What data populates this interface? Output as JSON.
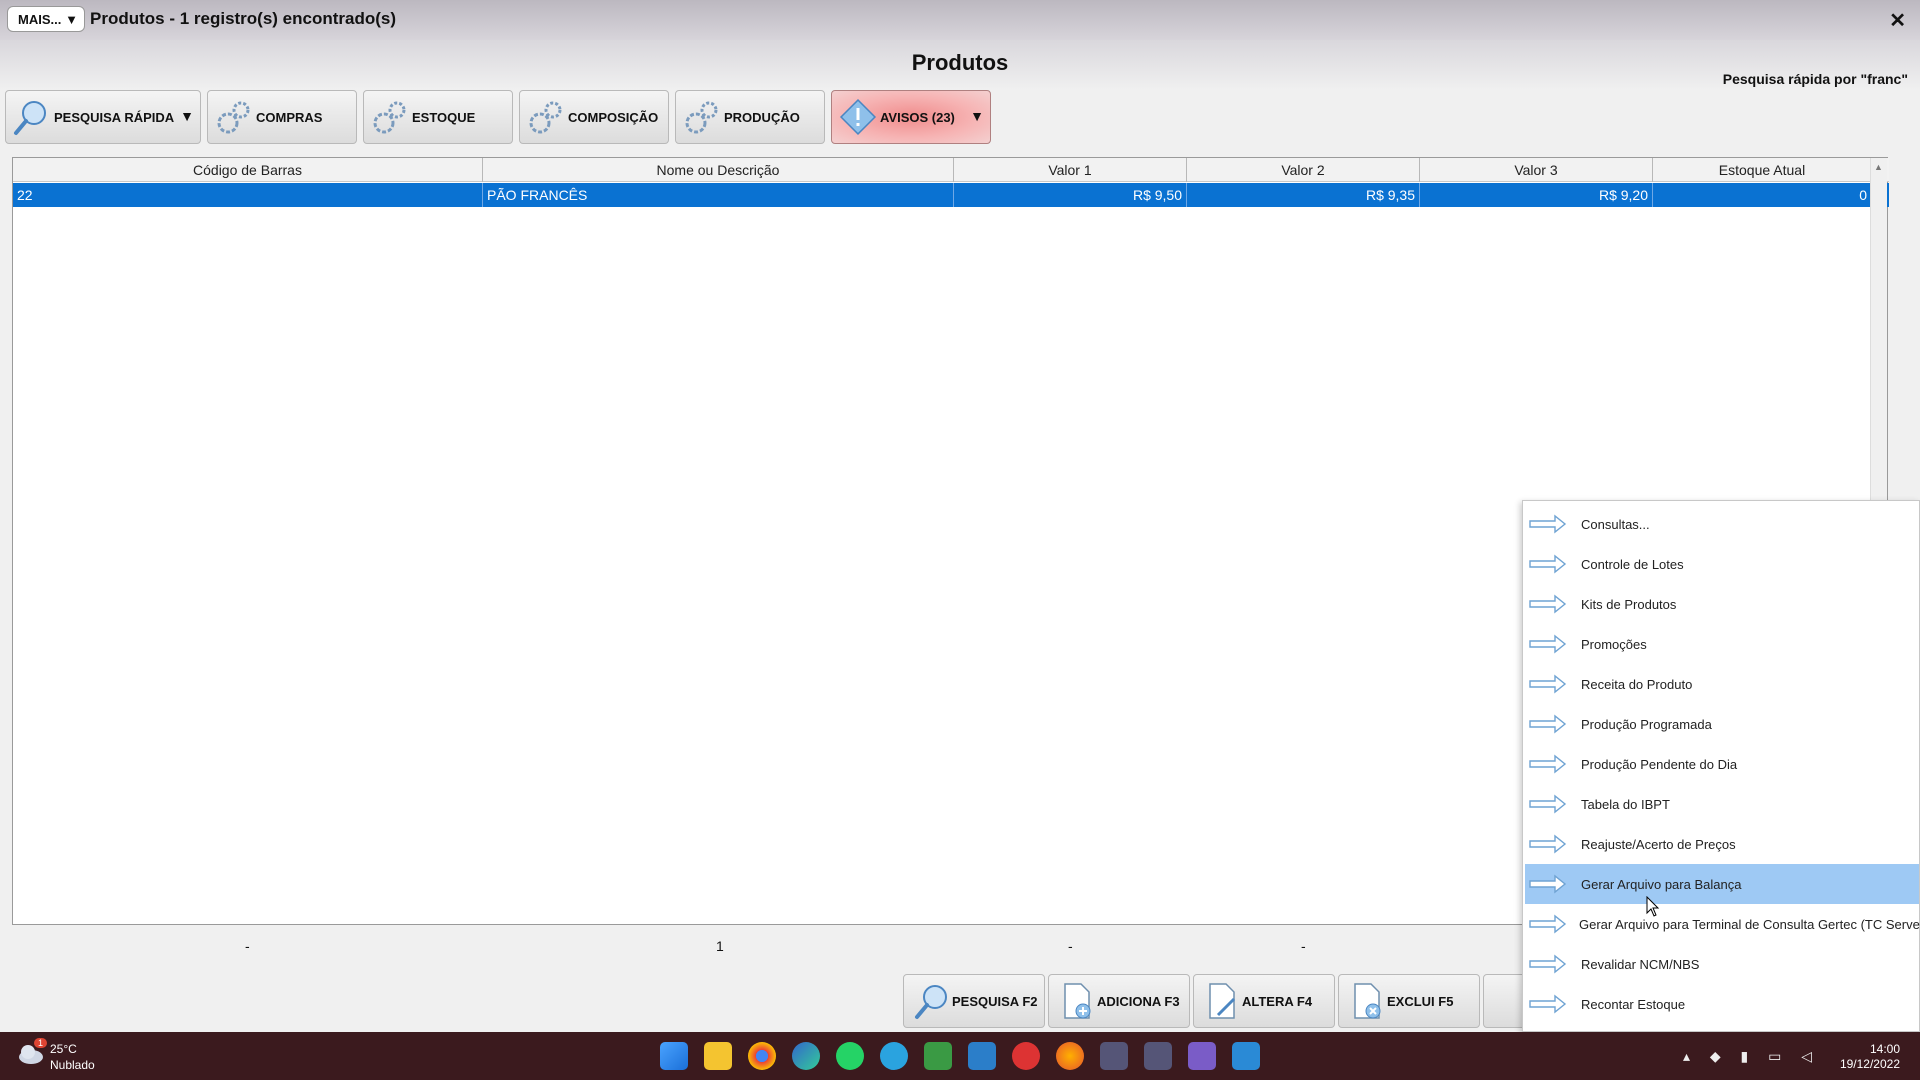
{
  "window": {
    "mais_label": "MAIS...",
    "title": "Produtos - 1 registro(s) encontrado(s)",
    "close": "✕"
  },
  "page_title": "Produtos",
  "quick_search_text": "Pesquisa rápida por \"franc\"",
  "toolbar": {
    "pesquisa": "PESQUISA RÁPIDA",
    "compras": "COMPRAS",
    "estoque": "ESTOQUE",
    "composicao": "COMPOSIÇÃO",
    "producao": "PRODUÇÃO",
    "avisos": "AVISOS (23)"
  },
  "grid": {
    "columns": [
      "Código de Barras",
      "Nome ou Descrição",
      "Valor 1",
      "Valor 2",
      "Valor 3",
      "Estoque Atual"
    ],
    "rows": [
      [
        "22",
        "PÃO FRANCÊS",
        "R$ 9,50",
        "R$ 9,35",
        "R$ 9,20",
        "0"
      ]
    ]
  },
  "footer": {
    "c1": "-",
    "c2": "1",
    "c3": "-",
    "c4": "-"
  },
  "bottom_buttons": {
    "pesquisa": "PESQUISA F2",
    "adiciona": "ADICIONA F3",
    "altera": "ALTERA F4",
    "exclui": "EXCLUI F5"
  },
  "menu": {
    "items": [
      "Consultas...",
      "Controle de Lotes",
      "Kits de Produtos",
      "Promoções",
      "Receita do Produto",
      "Produção Programada",
      "Produção Pendente do Dia",
      "Tabela do IBPT",
      "Reajuste/Acerto de Preços",
      "Gerar Arquivo para Balança",
      "Gerar Arquivo para Terminal de Consulta Gertec (TC Server)",
      "Revalidar NCM/NBS",
      "Recontar Estoque"
    ],
    "highlighted": "Gerar Arquivo para Balança"
  },
  "taskbar": {
    "weather_badge": "1",
    "temperature": "25°C",
    "condition": "Nublado",
    "time": "14:00",
    "date": "19/12/2022"
  },
  "colors": {
    "selection": "#0a72d2",
    "menu_highlight": "#9ec9f4",
    "taskbar": "#3b1a1e"
  }
}
